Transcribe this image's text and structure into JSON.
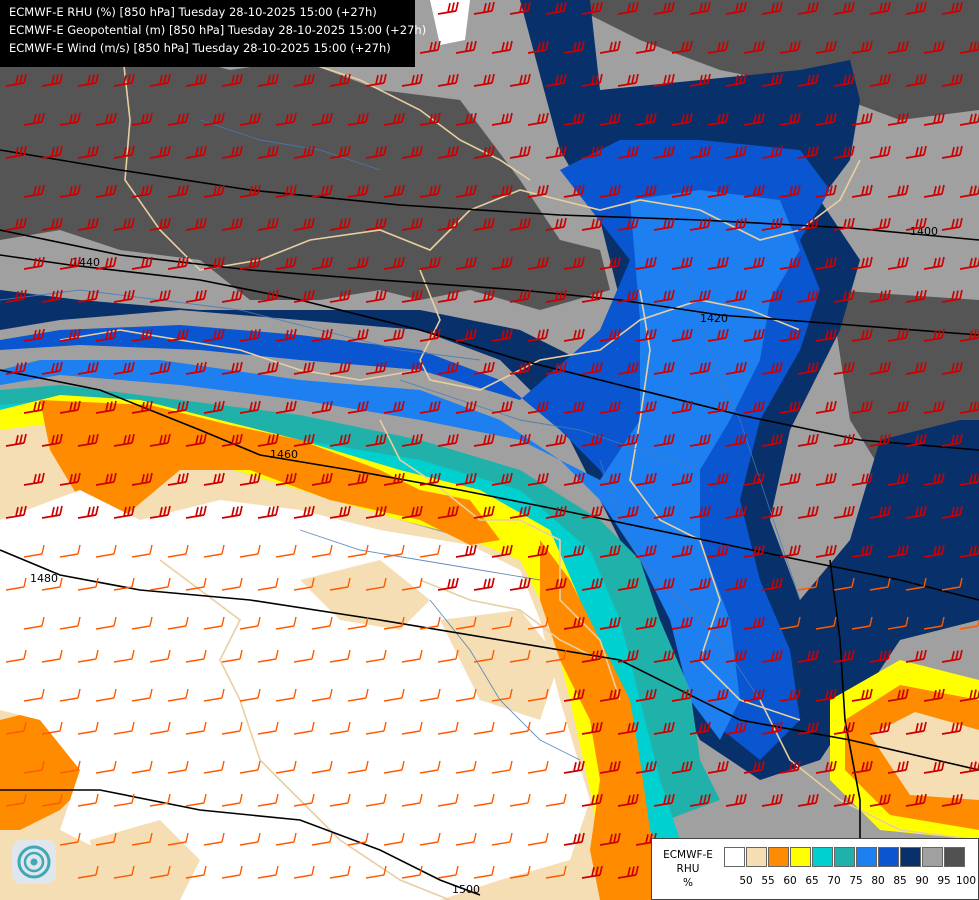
{
  "header": {
    "lines": [
      "ECMWF-E RHU (%) [850 hPa] Tuesday 28-10-2025 15:00 (+27h)",
      "ECMWF-E Geopotential (m) [850 hPa] Tuesday 28-10-2025 15:00 (+27h)",
      "ECMWF-E Wind (m/s) [850 hPa] Tuesday 28-10-2025 15:00 (+27h)"
    ]
  },
  "contour_labels": [
    "1400",
    "1420",
    "1440",
    "1460",
    "1480",
    "1500"
  ],
  "legend": {
    "title_line1": "ECMWF-E",
    "title_line2": "RHU",
    "title_line3": "%",
    "colors": [
      "#ffffff",
      "#f5deb3",
      "#ff8c00",
      "#ffff00",
      "#00d0d0",
      "#20b2aa",
      "#1e7ff0",
      "#0a55d0",
      "#08306b",
      "#a0a0a0",
      "#505050"
    ],
    "labels": [
      "50",
      "55",
      "60",
      "65",
      "70",
      "75",
      "80",
      "85",
      "90",
      "95",
      "100"
    ]
  },
  "colors": {
    "border": "#e8cfa0",
    "rivers": "#4a7ab5",
    "wind_strong": "#cc0000",
    "wind_medium": "#ff5a00",
    "wind_light": "#f0a0c0",
    "isohypse": "#000000"
  }
}
